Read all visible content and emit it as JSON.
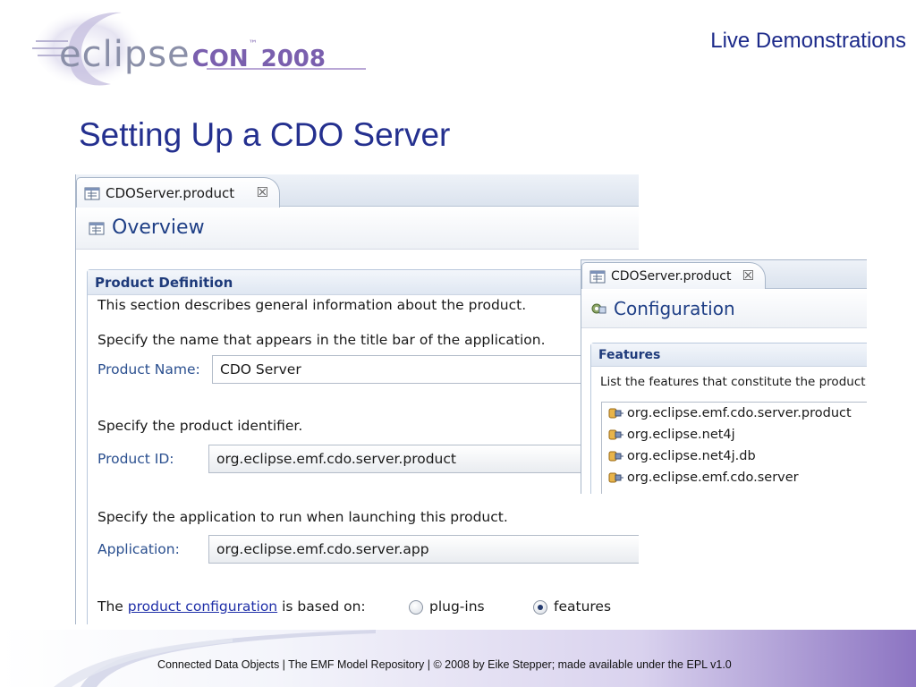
{
  "slide": {
    "logo": {
      "eclipse": "eclipse",
      "con": "CON",
      "tm": "™",
      "year": "2008"
    },
    "section_label": "Live Demonstrations",
    "title": "Setting Up a CDO Server",
    "footer": "Connected Data Objects  |  The EMF Model Repository  |  © 2008 by Eike Stepper; made available under the EPL v1.0"
  },
  "overview_editor": {
    "tab_label": "CDOServer.product",
    "tab_close": "☒",
    "form_title": "Overview",
    "section_title": "Product Definition",
    "description": "This section describes general information about the product.",
    "name_hint": "Specify the name that appears in the title bar of the application.",
    "product_name_label": "Product Name:",
    "product_name_value": "CDO Server",
    "id_hint": "Specify the product identifier.",
    "product_id_label": "Product ID:",
    "product_id_value": "org.eclipse.emf.cdo.server.product",
    "app_hint": "Specify the application to run when launching this product.",
    "application_label": "Application:",
    "application_value": "org.eclipse.emf.cdo.server.app",
    "based_on_prefix": "The",
    "based_on_link": "product configuration",
    "based_on_suffix": "is based on:",
    "radio_plugins": "plug-ins",
    "radio_features": "features",
    "selected_option": "features"
  },
  "configuration_editor": {
    "tab_label": "CDOServer.product",
    "tab_close": "☒",
    "form_title": "Configuration",
    "section_title": "Features",
    "description": "List the features that constitute the product.",
    "features": [
      "org.eclipse.emf.cdo.server.product",
      "org.eclipse.net4j",
      "org.eclipse.net4j.db",
      "org.eclipse.emf.cdo.server"
    ]
  },
  "colors": {
    "title_blue": "#24308f",
    "label_blue": "#2a4f8f",
    "link_blue": "#1f2fa8",
    "footer_purple": "#8c74c2"
  }
}
